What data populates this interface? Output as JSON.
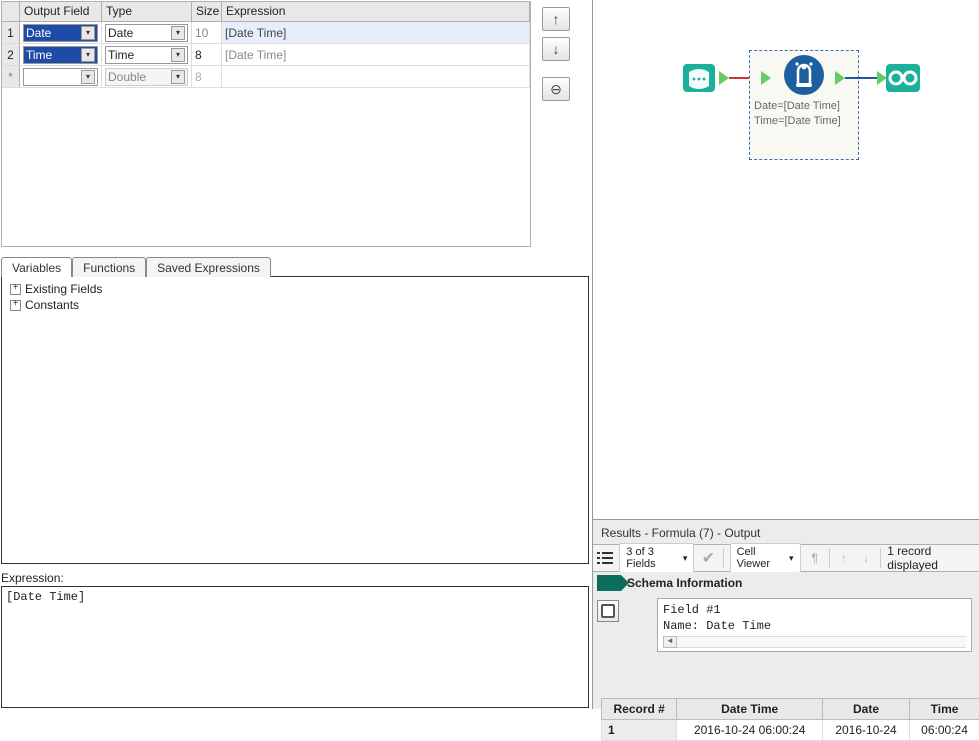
{
  "grid": {
    "headers": {
      "field": "Output Field",
      "type": "Type",
      "size": "Size",
      "expr": "Expression"
    },
    "rows": [
      {
        "num": "1",
        "field": "Date",
        "type": "Date",
        "size": "10",
        "expr": "[Date Time]",
        "selected": true
      },
      {
        "num": "2",
        "field": "Time",
        "type": "Time",
        "size": "8",
        "expr": "[Date Time]",
        "selected": false
      },
      {
        "num": "*",
        "field": "",
        "type": "Double",
        "size": "8",
        "expr": "",
        "new": true
      }
    ]
  },
  "tabs": {
    "variables": "Variables",
    "functions": "Functions",
    "saved": "Saved Expressions"
  },
  "tree": {
    "existing": "Existing Fields",
    "constants": "Constants"
  },
  "expression": {
    "label": "Expression:",
    "value": "[Date Time]"
  },
  "canvas": {
    "formula_annot_1": "Date=[Date Time]",
    "formula_annot_2": "Time=[Date Time]"
  },
  "results": {
    "title": "Results - Formula (7) - Output",
    "fields_dd": "3 of 3 Fields",
    "cell_viewer": "Cell Viewer",
    "records": "1 record displayed",
    "schema_title": "Schema Information",
    "schema_line1": "Field #1",
    "schema_line2": "Name: Date Time",
    "table": {
      "headers": {
        "rec": "Record #",
        "dt": "Date Time",
        "date": "Date",
        "time": "Time"
      },
      "row": {
        "rec": "1",
        "dt": "2016-10-24 06:00:24",
        "date": "2016-10-24",
        "time": "06:00:24"
      }
    }
  }
}
